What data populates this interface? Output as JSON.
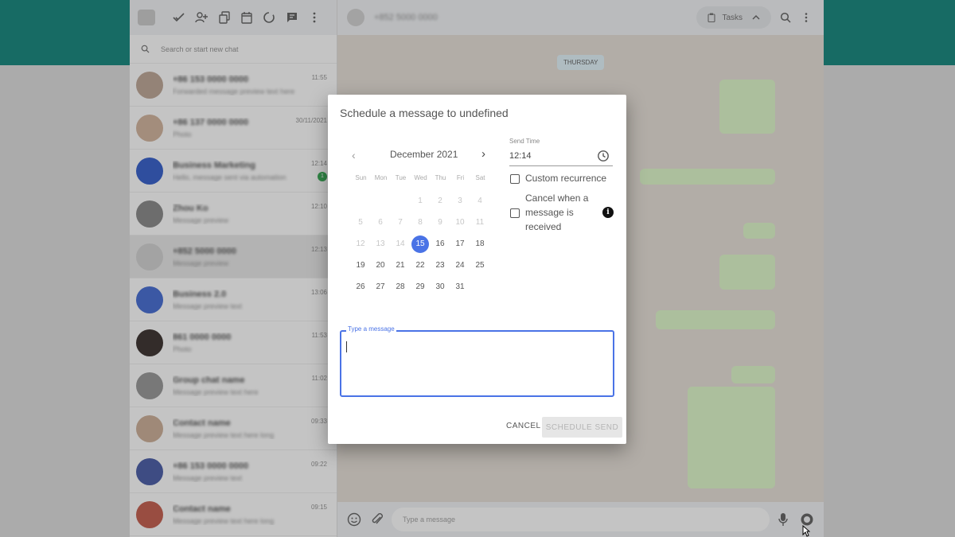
{
  "left": {
    "search_placeholder": "Search or start new chat",
    "chats": [
      {
        "name": "+86 153 0000 0000",
        "preview": "Forwarded message preview text here",
        "time": "11:55",
        "avatar_color": "#b9a08e"
      },
      {
        "name": "+86 137 0000 0000",
        "preview": "Photo",
        "time": "30/11/2021",
        "avatar_color": "#cfae96"
      },
      {
        "name": "Business Marketing",
        "preview": "Hello, message sent via automation",
        "time": "12:14",
        "avatar_color": "#2451c7",
        "unread": "1"
      },
      {
        "name": "Zhou Ko",
        "preview": "Message preview",
        "time": "12:10",
        "avatar_color": "#7f7f7f"
      },
      {
        "name": "+852 5000 0000",
        "preview": "Message preview",
        "time": "12:13",
        "avatar_color": "#cfcfcf"
      },
      {
        "name": "Business 2.0",
        "preview": "Message preview text",
        "time": "13:06",
        "avatar_color": "#3561d0"
      },
      {
        "name": "861 0000 0000",
        "preview": "Photo",
        "time": "11:53",
        "avatar_color": "#2a1f1c"
      },
      {
        "name": "Group chat name",
        "preview": "Message preview text here",
        "time": "11:02",
        "avatar_color": "#8f8f8f"
      },
      {
        "name": "Contact name",
        "preview": "Message preview text here long",
        "time": "09:33",
        "avatar_color": "#c9a98f"
      },
      {
        "name": "+86 153 0000 0000",
        "preview": "Message preview text",
        "time": "09:22",
        "avatar_color": "#3a4fa0"
      },
      {
        "name": "Contact name",
        "preview": "Message preview text here long",
        "time": "09:15",
        "avatar_color": "#c0503f"
      }
    ]
  },
  "right": {
    "contact_name": "+852 5000 0000",
    "tasks_label": "Tasks",
    "day_chip": "THURSDAY",
    "composer_placeholder": "Type a message"
  },
  "dialog": {
    "title": "Schedule a message to undefined",
    "calendar": {
      "month_label": "December 2021",
      "prev": "‹",
      "next": "›",
      "weekdays": [
        "Sun",
        "Mon",
        "Tue",
        "Wed",
        "Thu",
        "Fri",
        "Sat"
      ],
      "days": [
        [
          "",
          "",
          "",
          "1",
          "2",
          "3",
          "4"
        ],
        [
          "5",
          "6",
          "7",
          "8",
          "9",
          "10",
          "11"
        ],
        [
          "12",
          "13",
          "14",
          "15",
          "16",
          "17",
          "18"
        ],
        [
          "19",
          "20",
          "21",
          "22",
          "23",
          "24",
          "25"
        ],
        [
          "26",
          "27",
          "28",
          "29",
          "30",
          "31",
          ""
        ]
      ],
      "selected_day": "15",
      "disabled_until": "14"
    },
    "send_time_label": "Send Time",
    "send_time_value": "12:14",
    "custom_recurrence_label": "Custom recurrence",
    "cancel_when_label_1": "Cancel when a",
    "cancel_when_label_2": "message is",
    "cancel_when_label_3": "received",
    "info_glyph": "i",
    "message_label": "Type a message",
    "cancel_button": "CANCEL",
    "schedule_button": "SCHEDULE SEND"
  },
  "colors": {
    "accent": "#4a73e6",
    "header_teal": "#007d72"
  }
}
